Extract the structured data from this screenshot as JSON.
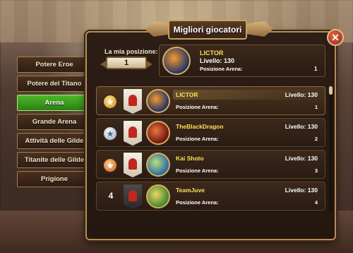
{
  "title": "Migliori giocatori",
  "close_label": "✕",
  "tabs": [
    {
      "label": "Potere Eroe",
      "active": false
    },
    {
      "label": "Potere del Titano",
      "active": false
    },
    {
      "label": "Arena",
      "active": true
    },
    {
      "label": "Grande Arena",
      "active": false
    },
    {
      "label": "Attività delle Gilde",
      "active": false
    },
    {
      "label": "Titanite delle Gilde",
      "active": false
    },
    {
      "label": "Prigione",
      "active": false
    }
  ],
  "my_position": {
    "label": "La mia posizione:",
    "value": "1",
    "player": "LICTOR",
    "level": "Livello: 130",
    "arena_label": "Posizione Arena:",
    "arena_value": "1"
  },
  "rows": [
    {
      "rank": "",
      "medal": "gold",
      "banner": "light",
      "portrait": "lictor",
      "name": "LICTOR",
      "level": "Livello: 130",
      "arena_label": "Posizione Arena:",
      "arena_value": "1"
    },
    {
      "rank": "",
      "medal": "silver",
      "banner": "light",
      "portrait": "dragon",
      "name": "TheBlackDragon",
      "level": "Livello: 130",
      "arena_label": "Posizione Arena:",
      "arena_value": "2"
    },
    {
      "rank": "",
      "medal": "bronze",
      "banner": "light",
      "portrait": "kai",
      "name": "Kai Shoto",
      "level": "Livello: 130",
      "arena_label": "Posizione Arena:",
      "arena_value": "3"
    },
    {
      "rank": "4",
      "medal": "none",
      "banner": "dark",
      "portrait": "juve",
      "name": "TeamJuve",
      "level": "Livello: 130",
      "arena_label": "Posizione Arena:",
      "arena_value": "4"
    }
  ],
  "icons": {
    "close": "close-icon",
    "medal": "medal-icon",
    "banner": "guild-banner-icon",
    "portrait": "hero-avatar"
  },
  "colors": {
    "accent_name": "#ffe04d",
    "active_tab": "#3a9c1e",
    "panel_border": "#b58d55"
  }
}
